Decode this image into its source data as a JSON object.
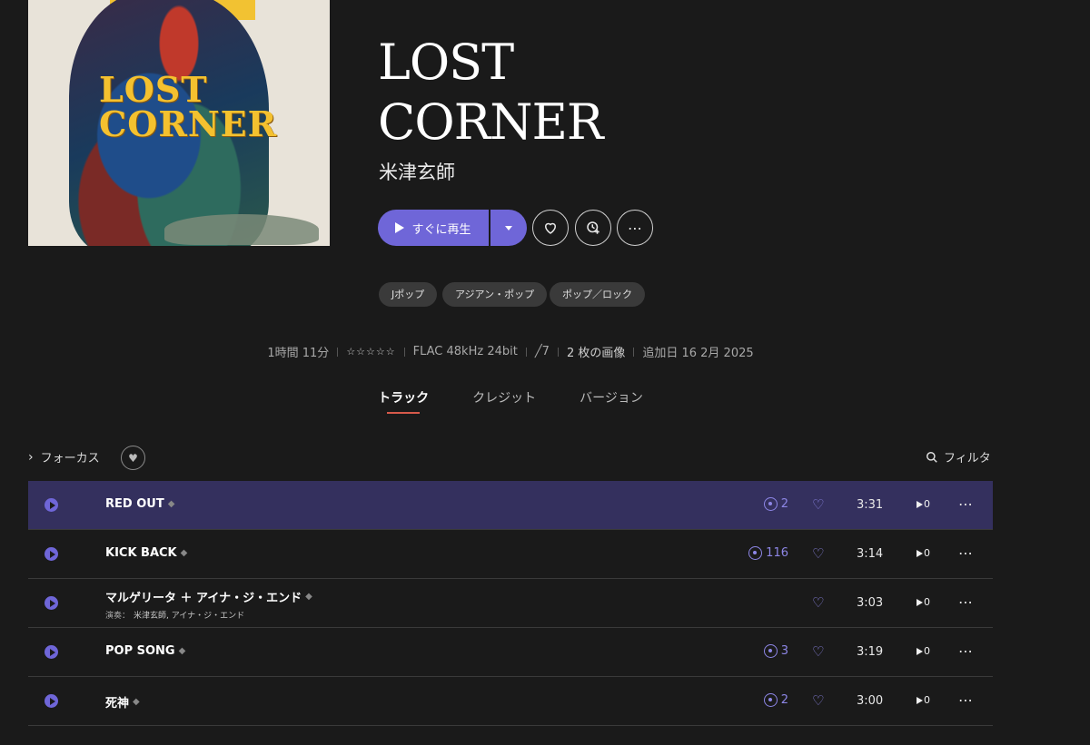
{
  "album": {
    "title_line1": "LOST",
    "title_line2": "CORNER",
    "artist": "米津玄師",
    "cover_text_line1": "LOST",
    "cover_text_line2": "CORNER"
  },
  "actions": {
    "play_label": "すぐに再生",
    "more_glyph": "⋯"
  },
  "tags": [
    "Jポップ",
    "アジアン・ポップ",
    "ポップ／ロック"
  ],
  "meta": {
    "duration": "1時間 11分",
    "rating_stars": "☆☆☆☆☆",
    "format": "FLAC 48kHz 24bit",
    "volume": "╱7",
    "images": "2 枚の画像",
    "added": "追加日 16 2月 2025"
  },
  "tabs": [
    "トラック",
    "クレジット",
    "バージョン"
  ],
  "list_controls": {
    "focus_label": "フォーカス",
    "filter_label": "フィルタ"
  },
  "tracks": [
    {
      "title": "RED OUT",
      "plays": "2",
      "duration": "3:31",
      "queue": "0",
      "active": true
    },
    {
      "title": "KICK BACK",
      "plays": "116",
      "duration": "3:14",
      "queue": "0"
    },
    {
      "title": "マルゲリータ ＋ アイナ・ジ・エンド",
      "performer_key": "演奏：",
      "performers": "米津玄師, アイナ・ジ・エンド",
      "plays": "",
      "duration": "3:03",
      "queue": "0"
    },
    {
      "title": "POP SONG",
      "plays": "3",
      "duration": "3:19",
      "queue": "0"
    },
    {
      "title": "死神",
      "plays": "2",
      "duration": "3:00",
      "queue": "0"
    }
  ],
  "colors": {
    "accent": "#6f66d8",
    "active_row": "#34305e",
    "background": "#1a1a1a",
    "tab_underline": "#d65a4a"
  }
}
